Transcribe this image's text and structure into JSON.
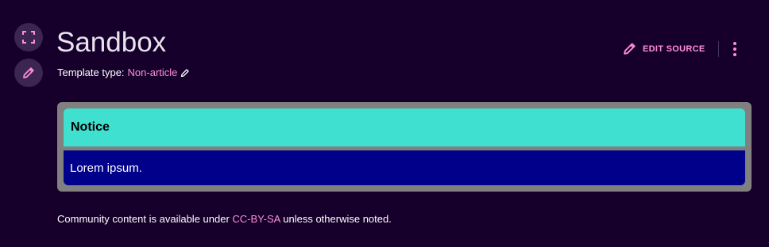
{
  "page": {
    "title": "Sandbox"
  },
  "template": {
    "label": "Template type:",
    "value": "Non-article"
  },
  "actions": {
    "edit_source_label": "EDIT SOURCE"
  },
  "notice": {
    "header": "Notice",
    "body": "Lorem ipsum."
  },
  "footer": {
    "prefix": "Community content is available under",
    "license": "CC-BY-SA",
    "suffix": "unless otherwise noted."
  },
  "colors": {
    "background": "#16002b",
    "accent": "#ff8fd6",
    "notice_header": "#40e0d0",
    "notice_body": "#00008b",
    "notice_border": "#808080"
  },
  "icons": {
    "fullscreen": "fullscreen-icon",
    "side_edit": "pencil-icon",
    "template_edit": "pencil-icon",
    "edit_source": "pencil-icon",
    "more": "more-vertical-icon"
  }
}
